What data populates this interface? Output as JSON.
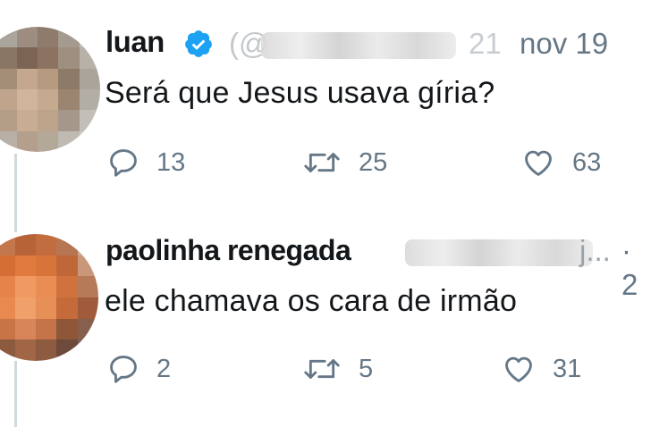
{
  "tweets": [
    {
      "author": "luan",
      "handle_prefix": "(@",
      "date": "nov 19",
      "date_partial": "21",
      "text": "Será que Jesus usava gíria?",
      "replies": "13",
      "retweets": "25",
      "likes": "63",
      "icons": [
        "reply-icon",
        "retweet-icon",
        "like-icon",
        "verified-badge-icon"
      ]
    },
    {
      "author": "paolinha renegada",
      "handle_suffix": "j...",
      "meta_tail": "· 2",
      "text": "ele chamava os cara de irmão",
      "replies": "2",
      "retweets": "5",
      "likes": "31",
      "icons": [
        "reply-icon",
        "retweet-icon",
        "like-icon"
      ]
    }
  ],
  "colors": {
    "verified": "#1da1f2",
    "muted": "#657786",
    "thread_line": "#cfd9de"
  }
}
